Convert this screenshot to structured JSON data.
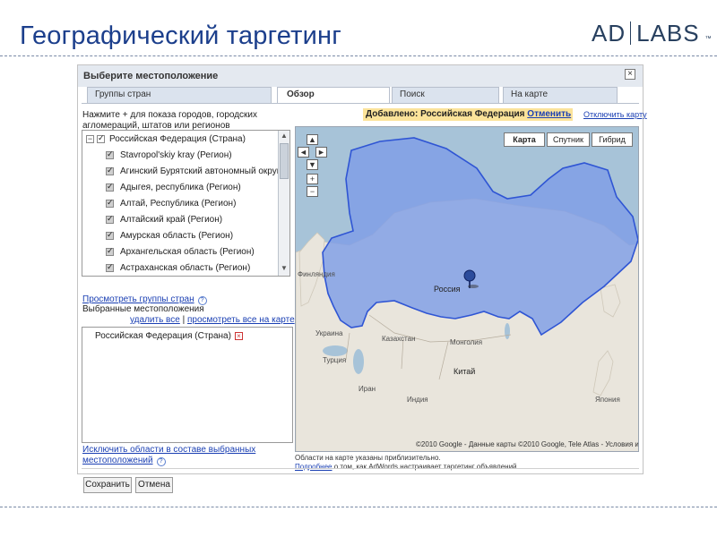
{
  "slide": {
    "title": "Географический таргетинг",
    "brand_left": "AD",
    "brand_right": "LABS",
    "brand_mark": "™"
  },
  "dialog": {
    "title": "Выберите местоположение",
    "close_glyph": "×",
    "tabs": [
      "Группы стран",
      "Обзор",
      "Поиск",
      "На карте"
    ],
    "active_tab": "Обзор",
    "instruction": "Нажмите + для показа городов, городских агломераций, штатов или регионов",
    "tree": [
      {
        "label": "Российская Федерация (Страна)",
        "level": 0,
        "expander": "−",
        "checked": true
      },
      {
        "label": "Stavropol'skiy kray (Регион)",
        "level": 1,
        "checked": true
      },
      {
        "label": "Агинский Бурятский автономный округ (Регион)",
        "level": 1,
        "checked": true
      },
      {
        "label": "Адыгея, республика (Регион)",
        "level": 1,
        "checked": true
      },
      {
        "label": "Алтай, Республика (Регион)",
        "level": 1,
        "checked": true
      },
      {
        "label": "Алтайский край (Регион)",
        "level": 1,
        "checked": true
      },
      {
        "label": "Амурская область (Регион)",
        "level": 1,
        "checked": true
      },
      {
        "label": "Архангельская область (Регион)",
        "level": 1,
        "checked": true
      },
      {
        "label": "Астраханская область (Регион)",
        "level": 1,
        "checked": true
      }
    ],
    "country_groups_link": "Просмотреть группы стран",
    "selected_heading": "Выбранные местоположения",
    "remove_all_link": "удалить все",
    "separator": "|",
    "view_all_link": "просмотреть все на карте",
    "selected_items": [
      "Российская Федерация (Страна)"
    ],
    "exclude_link_line1": "Исключить области в составе выбранных",
    "exclude_link_line2": "местоположений",
    "help_glyph": "?",
    "added_bar": {
      "prefix": "Добавлено: Российская Федерация",
      "undo": "Отменить"
    },
    "disable_map_link": "Отключить карту",
    "map_types": [
      "Карта",
      "Спутник",
      "Гибрид"
    ],
    "active_map_type": "Карта",
    "zoom_controls": [
      "▲",
      "◄",
      "►",
      "▼",
      "+",
      "−"
    ],
    "map_labels": {
      "russia": "Россия",
      "finland": "Финляндия",
      "kazakhstan": "Казахстан",
      "mongolia": "Монголия",
      "china": "Китай",
      "india": "Индия",
      "turkey": "Турция",
      "ukraine": "Украина",
      "iran": "Иран",
      "japan": "Япония"
    },
    "copyright": "©2010 Google - Данные карты ©2010 Google, Tele Atlas - Условия использования",
    "note_line1": "Области на карте указаны приблизительно.",
    "note_line2_link": "Подробнее",
    "note_line2_rest": "о том, как AdWords настраивает таргетинг объявлений",
    "save_label": "Сохранить",
    "cancel_label": "Отмена"
  },
  "colors": {
    "title": "#1c3f8c",
    "water": "#a7c3d8",
    "land": "#e9e5dc",
    "highlight_fill": "#7f9ee6",
    "highlight_stroke": "#2f55d4",
    "added_bar": "#fbe39a",
    "link": "#1a3fb3"
  }
}
